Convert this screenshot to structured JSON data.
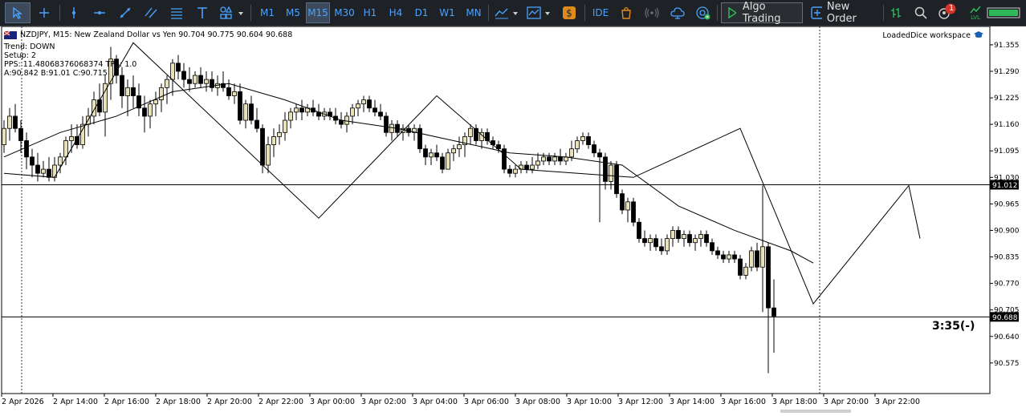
{
  "toolbar": {
    "timeframes": [
      "M1",
      "M5",
      "M15",
      "M30",
      "H1",
      "H4",
      "D1",
      "W1",
      "MN"
    ],
    "selected_timeframe": "M15",
    "ide_label": "IDE",
    "algo_label": "Algo Trading",
    "order_label": "New Order",
    "notification_count": "1",
    "lvl_label": "LVL"
  },
  "chart": {
    "header": "NZDJPY, M15:  New Zealand Dollar vs Yen  90.704 90.775 90.604 90.688",
    "info_lines": [
      "Trend: DOWN",
      "Setup: 2",
      "PPS: 11.48068376068374 TPS: 1.0",
      "A:90.842 B:91.01 C:90.715"
    ],
    "workspace_label": "LoadedDice workspace",
    "countdown": "3:35(-)",
    "hline1_label": "91.012",
    "hline2_label": "90.688",
    "y_labels": [
      "91.355",
      "91.290",
      "91.225",
      "91.160",
      "91.095",
      "91.030",
      "90.965",
      "90.900",
      "90.835",
      "90.770",
      "90.705",
      "90.640",
      "90.575"
    ],
    "x_labels": [
      "2 Apr 2026",
      "2 Apr 14:00",
      "2 Apr 16:00",
      "2 Apr 18:00",
      "2 Apr 20:00",
      "2 Apr 22:00",
      "3 Apr 00:00",
      "3 Apr 02:00",
      "3 Apr 04:00",
      "3 Apr 06:00",
      "3 Apr 08:00",
      "3 Apr 10:00",
      "3 Apr 12:00",
      "3 Apr 14:00",
      "3 Apr 16:00",
      "3 Apr 18:00",
      "3 Apr 20:00",
      "3 Apr 22:00"
    ]
  },
  "colors": {
    "bull_fill": "#e8e0b8",
    "bear_fill": "#000000",
    "toolbar_bg": "#1e2125",
    "accent": "#4aa3ff"
  },
  "chart_data": {
    "type": "candlestick",
    "symbol": "NZDJPY",
    "timeframe": "M15",
    "ylim": [
      90.5,
      91.4
    ],
    "ohlc": [
      [
        91.11,
        91.17,
        91.09,
        91.15
      ],
      [
        91.15,
        91.2,
        91.12,
        91.18
      ],
      [
        91.18,
        91.21,
        91.14,
        91.15
      ],
      [
        91.15,
        91.17,
        91.09,
        91.12
      ],
      [
        91.12,
        91.14,
        91.05,
        91.08
      ],
      [
        91.08,
        91.1,
        91.03,
        91.06
      ],
      [
        91.06,
        91.09,
        91.02,
        91.04
      ],
      [
        91.04,
        91.07,
        91.03,
        91.05
      ],
      [
        91.05,
        91.08,
        91.02,
        91.03
      ],
      [
        91.03,
        91.08,
        91.02,
        91.06
      ],
      [
        91.06,
        91.09,
        91.04,
        91.08
      ],
      [
        91.08,
        91.13,
        91.06,
        91.12
      ],
      [
        91.12,
        91.16,
        91.09,
        91.13
      ],
      [
        91.13,
        91.16,
        91.1,
        91.11
      ],
      [
        91.11,
        91.18,
        91.1,
        91.16
      ],
      [
        91.16,
        91.2,
        91.13,
        91.18
      ],
      [
        91.18,
        91.24,
        91.16,
        91.22
      ],
      [
        91.22,
        91.26,
        91.18,
        91.19
      ],
      [
        91.19,
        91.28,
        91.13,
        91.26
      ],
      [
        91.26,
        91.35,
        91.22,
        91.32
      ],
      [
        91.32,
        91.33,
        91.26,
        91.28
      ],
      [
        91.28,
        91.3,
        91.2,
        91.23
      ],
      [
        91.23,
        91.27,
        91.18,
        91.25
      ],
      [
        91.25,
        91.28,
        91.2,
        91.23
      ],
      [
        91.23,
        91.26,
        91.18,
        91.2
      ],
      [
        91.2,
        91.23,
        91.14,
        91.18
      ],
      [
        91.18,
        91.22,
        91.15,
        91.21
      ],
      [
        91.21,
        91.24,
        91.18,
        91.22
      ],
      [
        91.22,
        91.26,
        91.19,
        91.25
      ],
      [
        91.25,
        91.28,
        91.21,
        91.27
      ],
      [
        91.27,
        91.32,
        91.23,
        91.31
      ],
      [
        91.31,
        91.33,
        91.27,
        91.29
      ],
      [
        91.29,
        91.31,
        91.25,
        91.27
      ],
      [
        91.27,
        91.3,
        91.24,
        91.26
      ],
      [
        91.26,
        91.29,
        91.25,
        91.28
      ],
      [
        91.28,
        91.3,
        91.25,
        91.26
      ],
      [
        91.26,
        91.29,
        91.24,
        91.27
      ],
      [
        91.27,
        91.29,
        91.24,
        91.25
      ],
      [
        91.25,
        91.28,
        91.23,
        91.26
      ],
      [
        91.26,
        91.29,
        91.24,
        91.25
      ],
      [
        91.25,
        91.27,
        91.22,
        91.23
      ],
      [
        91.23,
        91.26,
        91.21,
        91.24
      ],
      [
        91.24,
        91.26,
        91.16,
        91.17
      ],
      [
        91.17,
        91.22,
        91.15,
        91.21
      ],
      [
        91.21,
        91.23,
        91.16,
        91.17
      ],
      [
        91.17,
        91.2,
        91.14,
        91.15
      ],
      [
        91.15,
        91.16,
        91.04,
        91.06
      ],
      [
        91.06,
        91.13,
        91.04,
        91.11
      ],
      [
        91.11,
        91.15,
        91.08,
        91.13
      ],
      [
        91.13,
        91.16,
        91.11,
        91.14
      ],
      [
        91.14,
        91.19,
        91.12,
        91.17
      ],
      [
        91.17,
        91.2,
        91.15,
        91.19
      ],
      [
        91.19,
        91.21,
        91.17,
        91.2
      ],
      [
        91.2,
        91.22,
        91.17,
        91.19
      ],
      [
        91.19,
        91.21,
        91.18,
        91.2
      ],
      [
        91.2,
        91.22,
        91.18,
        91.19
      ],
      [
        91.19,
        91.21,
        91.17,
        91.18
      ],
      [
        91.18,
        91.2,
        91.17,
        91.19
      ],
      [
        91.19,
        91.2,
        91.17,
        91.18
      ],
      [
        91.18,
        91.2,
        91.16,
        91.17
      ],
      [
        91.17,
        91.19,
        91.15,
        91.16
      ],
      [
        91.16,
        91.19,
        91.14,
        91.18
      ],
      [
        91.18,
        91.21,
        91.16,
        91.2
      ],
      [
        91.2,
        91.22,
        91.18,
        91.21
      ],
      [
        91.21,
        91.23,
        91.19,
        91.22
      ],
      [
        91.22,
        91.23,
        91.19,
        91.2
      ],
      [
        91.2,
        91.22,
        91.18,
        91.19
      ],
      [
        91.19,
        91.21,
        91.17,
        91.18
      ],
      [
        91.18,
        91.19,
        91.13,
        91.14
      ],
      [
        91.14,
        91.17,
        91.12,
        91.16
      ],
      [
        91.16,
        91.17,
        91.13,
        91.14
      ],
      [
        91.14,
        91.16,
        91.12,
        91.15
      ],
      [
        91.15,
        91.16,
        91.13,
        91.14
      ],
      [
        91.14,
        91.16,
        91.12,
        91.15
      ],
      [
        91.15,
        91.16,
        91.09,
        91.1
      ],
      [
        91.1,
        91.11,
        91.06,
        91.08
      ],
      [
        91.08,
        91.1,
        91.06,
        91.09
      ],
      [
        91.09,
        91.11,
        91.07,
        91.08
      ],
      [
        91.08,
        91.09,
        91.04,
        91.05
      ],
      [
        91.05,
        91.1,
        91.05,
        91.09
      ],
      [
        91.09,
        91.11,
        91.07,
        91.1
      ],
      [
        91.1,
        91.13,
        91.08,
        91.11
      ],
      [
        91.11,
        91.14,
        91.08,
        91.13
      ],
      [
        91.13,
        91.16,
        91.11,
        91.15
      ],
      [
        91.15,
        91.16,
        91.11,
        91.12
      ],
      [
        91.12,
        91.15,
        91.1,
        91.14
      ],
      [
        91.14,
        91.15,
        91.11,
        91.12
      ],
      [
        91.12,
        91.13,
        91.1,
        91.11
      ],
      [
        91.11,
        91.12,
        91.09,
        91.1
      ],
      [
        91.1,
        91.11,
        91.04,
        91.05
      ],
      [
        91.05,
        91.06,
        91.03,
        91.04
      ],
      [
        91.04,
        91.06,
        91.03,
        91.05
      ],
      [
        91.05,
        91.07,
        91.04,
        91.06
      ],
      [
        91.06,
        91.07,
        91.04,
        91.05
      ],
      [
        91.05,
        91.08,
        91.04,
        91.06
      ],
      [
        91.06,
        91.09,
        91.05,
        91.07
      ],
      [
        91.07,
        91.09,
        91.06,
        91.08
      ],
      [
        91.08,
        91.09,
        91.06,
        91.07
      ],
      [
        91.07,
        91.09,
        91.06,
        91.08
      ],
      [
        91.08,
        91.1,
        91.06,
        91.07
      ],
      [
        91.07,
        91.09,
        91.06,
        91.08
      ],
      [
        91.08,
        91.12,
        91.07,
        91.1
      ],
      [
        91.1,
        91.13,
        91.09,
        91.12
      ],
      [
        91.12,
        91.14,
        91.11,
        91.13
      ],
      [
        91.13,
        91.14,
        91.1,
        91.11
      ],
      [
        91.11,
        91.12,
        91.08,
        91.09
      ],
      [
        91.09,
        91.1,
        90.92,
        91.08
      ],
      [
        91.08,
        91.09,
        91.0,
        91.02
      ],
      [
        91.02,
        91.07,
        91.0,
        91.06
      ],
      [
        91.06,
        91.07,
        90.98,
        90.99
      ],
      [
        90.99,
        91.0,
        90.94,
        90.95
      ],
      [
        90.95,
        90.98,
        90.92,
        90.97
      ],
      [
        90.97,
        90.98,
        90.91,
        90.92
      ],
      [
        90.92,
        90.93,
        90.87,
        90.88
      ],
      [
        90.88,
        90.9,
        90.86,
        90.87
      ],
      [
        90.87,
        90.89,
        90.85,
        90.88
      ],
      [
        90.88,
        90.89,
        90.85,
        90.86
      ],
      [
        90.86,
        90.88,
        90.84,
        90.85
      ],
      [
        90.85,
        90.89,
        90.84,
        90.88
      ],
      [
        90.88,
        90.91,
        90.86,
        90.9
      ],
      [
        90.9,
        90.91,
        90.87,
        90.88
      ],
      [
        90.88,
        90.9,
        90.86,
        90.89
      ],
      [
        90.89,
        90.9,
        90.86,
        90.87
      ],
      [
        90.87,
        90.89,
        90.85,
        90.88
      ],
      [
        90.88,
        90.9,
        90.86,
        90.89
      ],
      [
        90.89,
        90.9,
        90.86,
        90.87
      ],
      [
        90.87,
        90.88,
        90.84,
        90.85
      ],
      [
        90.85,
        90.86,
        90.83,
        90.84
      ],
      [
        90.84,
        90.85,
        90.82,
        90.83
      ],
      [
        90.83,
        90.85,
        90.82,
        90.84
      ],
      [
        90.84,
        90.85,
        90.82,
        90.83
      ],
      [
        90.83,
        90.84,
        90.78,
        90.79
      ],
      [
        90.79,
        90.82,
        90.78,
        90.81
      ],
      [
        90.81,
        90.86,
        90.8,
        90.85
      ],
      [
        90.85,
        90.87,
        90.8,
        90.81
      ],
      [
        90.81,
        91.01,
        90.7,
        90.86
      ],
      [
        90.86,
        90.87,
        90.55,
        90.71
      ],
      [
        90.71,
        90.78,
        90.6,
        90.69
      ]
    ],
    "ma_line": [
      [
        0,
        91.08
      ],
      [
        10,
        91.14
      ],
      [
        20,
        91.18
      ],
      [
        30,
        91.24
      ],
      [
        40,
        91.26
      ],
      [
        50,
        91.22
      ],
      [
        60,
        91.17
      ],
      [
        70,
        91.15
      ],
      [
        80,
        91.12
      ],
      [
        90,
        91.09
      ],
      [
        100,
        91.08
      ],
      [
        110,
        91.06
      ],
      [
        120,
        90.96
      ],
      [
        130,
        90.9
      ],
      [
        140,
        90.85
      ],
      [
        144,
        90.82
      ]
    ],
    "zigzag": [
      [
        0,
        91.04
      ],
      [
        9,
        91.03
      ],
      [
        23,
        91.36
      ],
      [
        56,
        90.93
      ],
      [
        77,
        91.23
      ],
      [
        92,
        91.05
      ],
      [
        112,
        91.03
      ],
      [
        131,
        91.15
      ],
      [
        144,
        90.72
      ],
      [
        161,
        91.01
      ],
      [
        163,
        90.88
      ]
    ],
    "hlines": [
      91.012,
      90.688
    ],
    "vlines_x": [
      3,
      145
    ],
    "countdown": "3:35(-)"
  }
}
